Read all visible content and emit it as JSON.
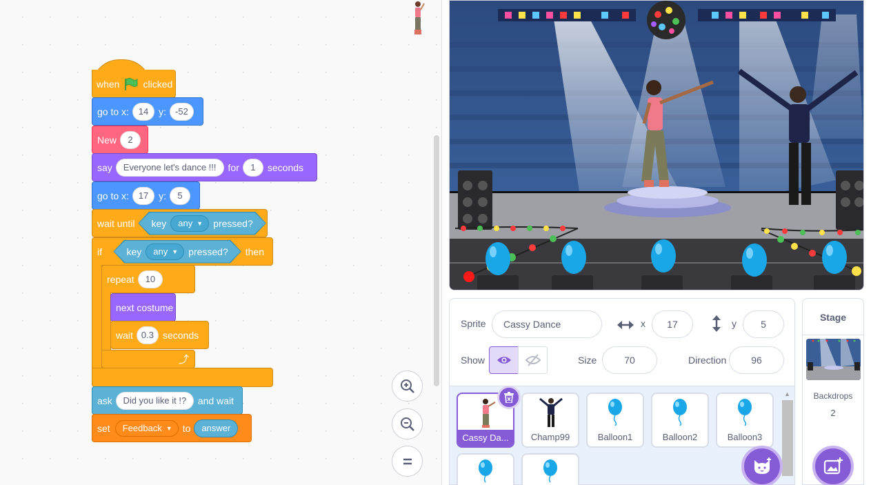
{
  "scripts": {
    "hat": {
      "when": "when",
      "clicked": "clicked"
    },
    "goto1": {
      "label": "go to x:",
      "x": "14",
      "ylabel": "y:",
      "y": "-52"
    },
    "new_block": {
      "label": "New",
      "value": "2"
    },
    "say": {
      "label": "say",
      "message": "Everyone let's dance !!!",
      "for": "for",
      "secs": "1",
      "seconds": "seconds"
    },
    "goto2": {
      "label": "go to x:",
      "x": "17",
      "ylabel": "y:",
      "y": "5"
    },
    "wait_until": {
      "label": "wait until",
      "key": "key",
      "key_option": "any",
      "pressed": "pressed?"
    },
    "if_block": {
      "label": "if",
      "key": "key",
      "key_option": "any",
      "pressed": "pressed?",
      "then": "then"
    },
    "repeat": {
      "label": "repeat",
      "count": "10"
    },
    "next_costume": {
      "label": "next costume"
    },
    "wait": {
      "label": "wait",
      "secs": "0.3",
      "seconds": "seconds"
    },
    "ask": {
      "label": "ask",
      "question": "Did you like it !?",
      "and_wait": "and wait"
    },
    "set": {
      "label": "set",
      "variable": "Feedback",
      "to": "to",
      "value": "answer"
    }
  },
  "sprite_info": {
    "sprite_label": "Sprite",
    "sprite_name": "Cassy Dance",
    "x_label": "x",
    "x": "17",
    "y_label": "y",
    "y": "5",
    "show_label": "Show",
    "size_label": "Size",
    "size": "70",
    "direction_label": "Direction",
    "direction": "96"
  },
  "sprites": [
    {
      "name": "Cassy Da...",
      "selected": true,
      "icon": "dancer-icon"
    },
    {
      "name": "Champ99",
      "selected": false,
      "icon": "dancer-icon"
    },
    {
      "name": "Balloon1",
      "selected": false,
      "icon": "balloon-icon"
    },
    {
      "name": "Balloon2",
      "selected": false,
      "icon": "balloon-icon"
    },
    {
      "name": "Balloon3",
      "selected": false,
      "icon": "balloon-icon"
    }
  ],
  "stage_pane": {
    "title": "Stage",
    "backdrops_label": "Backdrops",
    "backdrops_count": "2"
  },
  "colors": {
    "motion": "#4c97ff",
    "looks": "#9966ff",
    "control": "#ffab19",
    "sensing": "#5cb1d6",
    "variables": "#ff8c1a",
    "custom": "#ff6680",
    "accent": "#855cd6"
  }
}
